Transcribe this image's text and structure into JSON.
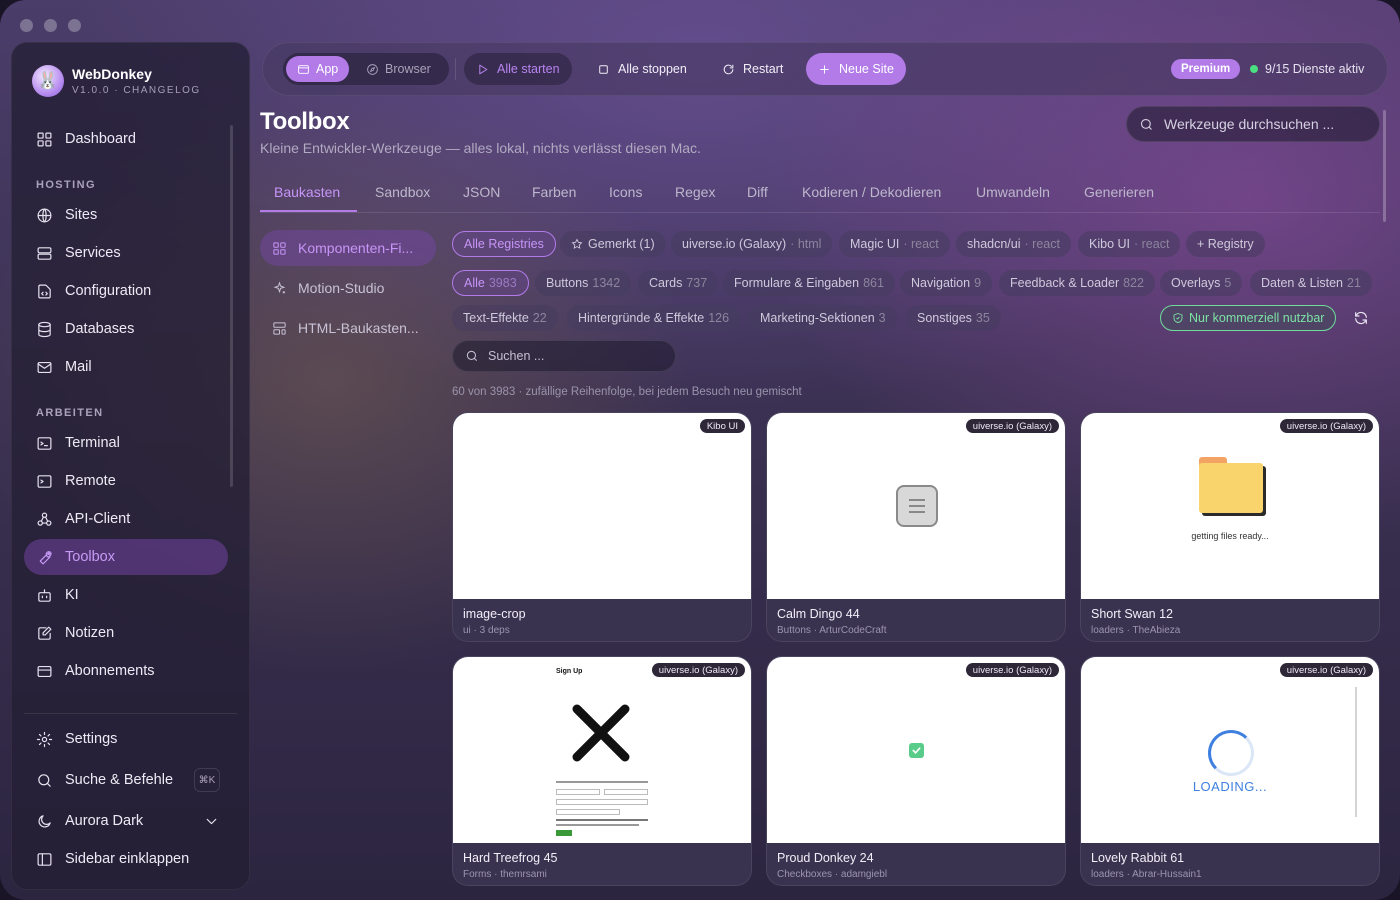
{
  "brand": {
    "name": "WebDonkey",
    "version": "V1.0.0",
    "changelog": "CHANGELOG"
  },
  "sidebar": {
    "dashboard": "Dashboard",
    "hosting_label": "HOSTING",
    "hosting": [
      "Sites",
      "Services",
      "Configuration",
      "Databases",
      "Mail"
    ],
    "arbeiten_label": "ARBEITEN",
    "arbeiten": [
      "Terminal",
      "Remote",
      "API-Client",
      "Toolbox",
      "KI",
      "Notizen",
      "Abonnements"
    ],
    "active": "Toolbox",
    "settings": "Settings",
    "search": "Suche & Befehle",
    "search_kbd": "⌘K",
    "theme": "Aurora Dark",
    "collapse": "Sidebar einklappen"
  },
  "topbar": {
    "app": "App",
    "browser": "Browser",
    "start_all": "Alle starten",
    "stop_all": "Alle stoppen",
    "restart": "Restart",
    "new_site": "Neue Site",
    "premium": "Premium",
    "services_status": "9/15 Dienste aktiv",
    "accent": "#b27be8",
    "status_color": "#4ade80"
  },
  "header": {
    "title": "Toolbox",
    "subtitle": "Kleine Entwickler-Werkzeuge — alles lokal, nichts verlässt diesen Mac.",
    "search_placeholder": "Werkzeuge durchsuchen ..."
  },
  "tabs": [
    "Baukasten",
    "Sandbox",
    "JSON",
    "Farben",
    "Icons",
    "Regex",
    "Diff",
    "Kodieren / Dekodieren",
    "Umwandeln",
    "Generieren"
  ],
  "subnav": [
    "Komponenten-Fi...",
    "Motion-Studio",
    "HTML-Baukasten..."
  ],
  "registries": [
    {
      "label": "Alle Registries",
      "sub": ""
    },
    {
      "label": "Gemerkt (1)",
      "sub": ""
    },
    {
      "label": "uiverse.io (Galaxy)",
      "sub": "· html"
    },
    {
      "label": "Magic UI",
      "sub": "· react"
    },
    {
      "label": "shadcn/ui",
      "sub": "· react"
    },
    {
      "label": "Kibo UI",
      "sub": "· react"
    },
    {
      "label": "+ Registry",
      "sub": ""
    }
  ],
  "categories": [
    {
      "label": "Alle",
      "count": "3983"
    },
    {
      "label": "Buttons",
      "count": "1342"
    },
    {
      "label": "Cards",
      "count": "737"
    },
    {
      "label": "Formulare & Eingaben",
      "count": "861"
    },
    {
      "label": "Navigation",
      "count": "9"
    },
    {
      "label": "Feedback & Loader",
      "count": "822"
    },
    {
      "label": "Overlays",
      "count": "5"
    },
    {
      "label": "Daten & Listen",
      "count": "21"
    },
    {
      "label": "Text-Effekte",
      "count": "22"
    },
    {
      "label": "Hintergründe & Effekte",
      "count": "126"
    },
    {
      "label": "Marketing-Sektionen",
      "count": "3"
    },
    {
      "label": "Sonstiges",
      "count": "35"
    }
  ],
  "commercial_filter": "Nur kommerziell nutzbar",
  "component_search_placeholder": "Suchen ...",
  "result_info": "60 von 3983 · zufällige Reihenfolge, bei jedem Besuch neu gemischt",
  "cards": [
    {
      "badge": "Kibo UI",
      "name": "image-crop",
      "meta": "ui · 3 deps"
    },
    {
      "badge": "uiverse.io (Galaxy)",
      "name": "Calm Dingo 44",
      "meta": "Buttons · ArturCodeCraft"
    },
    {
      "badge": "uiverse.io (Galaxy)",
      "name": "Short Swan 12",
      "meta": "loaders · TheAbieza",
      "preview_text": "getting files ready..."
    },
    {
      "badge": "uiverse.io (Galaxy)",
      "name": "Hard Treefrog 45",
      "meta": "Forms · themrsami",
      "preview_text": "Sign Up"
    },
    {
      "badge": "uiverse.io (Galaxy)",
      "name": "Proud Donkey 24",
      "meta": "Checkboxes · adamgiebl"
    },
    {
      "badge": "uiverse.io (Galaxy)",
      "name": "Lovely Rabbit 61",
      "meta": "loaders · Abrar-Hussain1",
      "preview_text": "LOADING..."
    }
  ]
}
